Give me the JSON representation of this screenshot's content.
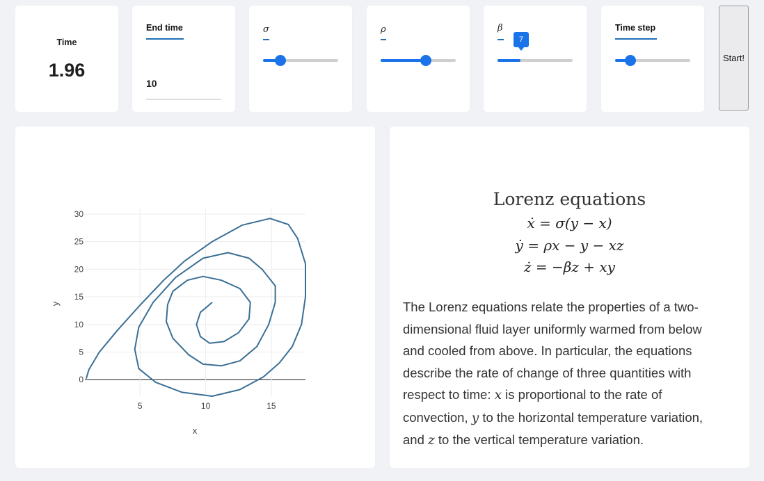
{
  "time_card": {
    "label": "Time",
    "value": "1.96"
  },
  "end_time": {
    "label": "End time",
    "value": "10"
  },
  "sliders": [
    {
      "key": "sigma",
      "label": "σ",
      "fraction": 0.23
    },
    {
      "key": "rho",
      "label": "ρ",
      "fraction": 0.6
    },
    {
      "key": "beta",
      "label": "β",
      "fraction": 0.31,
      "tooltip": "7"
    },
    {
      "key": "timestep",
      "label": "Time step",
      "fraction": 0.2
    }
  ],
  "start_button": {
    "label": "Start!"
  },
  "colors": {
    "accent": "#1a73e8",
    "line": "#3a6f94",
    "underline": "#1f6fb5"
  },
  "chart_data": {
    "type": "line",
    "xlabel": "x",
    "ylabel": "y",
    "xlim": [
      0.8,
      17.6
    ],
    "ylim": [
      -3,
      31
    ],
    "x_ticks": [
      "5",
      "10",
      "15"
    ],
    "y_ticks": [
      "0",
      "5",
      "10",
      "15",
      "20",
      "25",
      "30"
    ],
    "grid": true,
    "series": [
      {
        "x": [
          0.9,
          1.1,
          1.9,
          3.3,
          5.0,
          6.8,
          8.4,
          10.5,
          12.8,
          14.9,
          16.3,
          17.0,
          17.6,
          17.6,
          17.3,
          16.6,
          15.6,
          14.4,
          12.6,
          10.5,
          8.2,
          6.2,
          4.9,
          4.6,
          4.9,
          6.0,
          7.7,
          9.8,
          11.7,
          13.3,
          14.3,
          15.3,
          15.3,
          14.8,
          13.9,
          12.6,
          11.2,
          9.8,
          8.7,
          7.5,
          7.0,
          7.1,
          7.5,
          8.6,
          9.8,
          11.2,
          12.6,
          13.4,
          13.3,
          12.5,
          11.4,
          10.3,
          9.6,
          9.3,
          9.6,
          10.5
        ],
        "y": [
          0.2,
          1.8,
          5.0,
          9.0,
          13.5,
          18.0,
          21.5,
          25.0,
          28.0,
          29.2,
          28.1,
          25.6,
          21.0,
          15.0,
          10.0,
          6.0,
          3.0,
          0.5,
          -1.8,
          -3.0,
          -2.3,
          -0.5,
          2.0,
          5.5,
          9.5,
          14.0,
          18.5,
          22.0,
          23.0,
          22.0,
          20.0,
          17.0,
          14.0,
          10.0,
          6.0,
          3.4,
          2.5,
          2.8,
          4.5,
          7.5,
          10.5,
          13.6,
          16.0,
          18.0,
          18.7,
          18.0,
          16.5,
          14.0,
          11.0,
          8.5,
          6.9,
          6.6,
          7.8,
          10.0,
          12.2,
          14.0
        ]
      }
    ]
  },
  "equations": {
    "title": "Lorenz equations",
    "eq1": {
      "lhs": "ẋ",
      "rhs": " = σ(y − x)"
    },
    "eq2": {
      "lhs": "ẏ",
      "rhs": " = ρx − y − xz"
    },
    "eq3": {
      "lhs": "ż",
      "rhs": " = −βz + xy"
    }
  },
  "description": {
    "line1": "The Lorenz equations relate the properties of a two-",
    "line2": "dimensional fluid layer uniformly warmed from below",
    "line3": "and cooled from above. In particular, the equations",
    "line4": "describe the rate of change of three quantities with",
    "line5_pre": "respect to time: ",
    "var_x": "x",
    "line5_post": " is proportional to the rate of",
    "line6_pre": "convection, ",
    "var_y": "y",
    "line6_post": " to the horizontal temperature variation,",
    "line7_pre": "and ",
    "var_z": "z",
    "line7_post": " to the vertical temperature variation."
  }
}
